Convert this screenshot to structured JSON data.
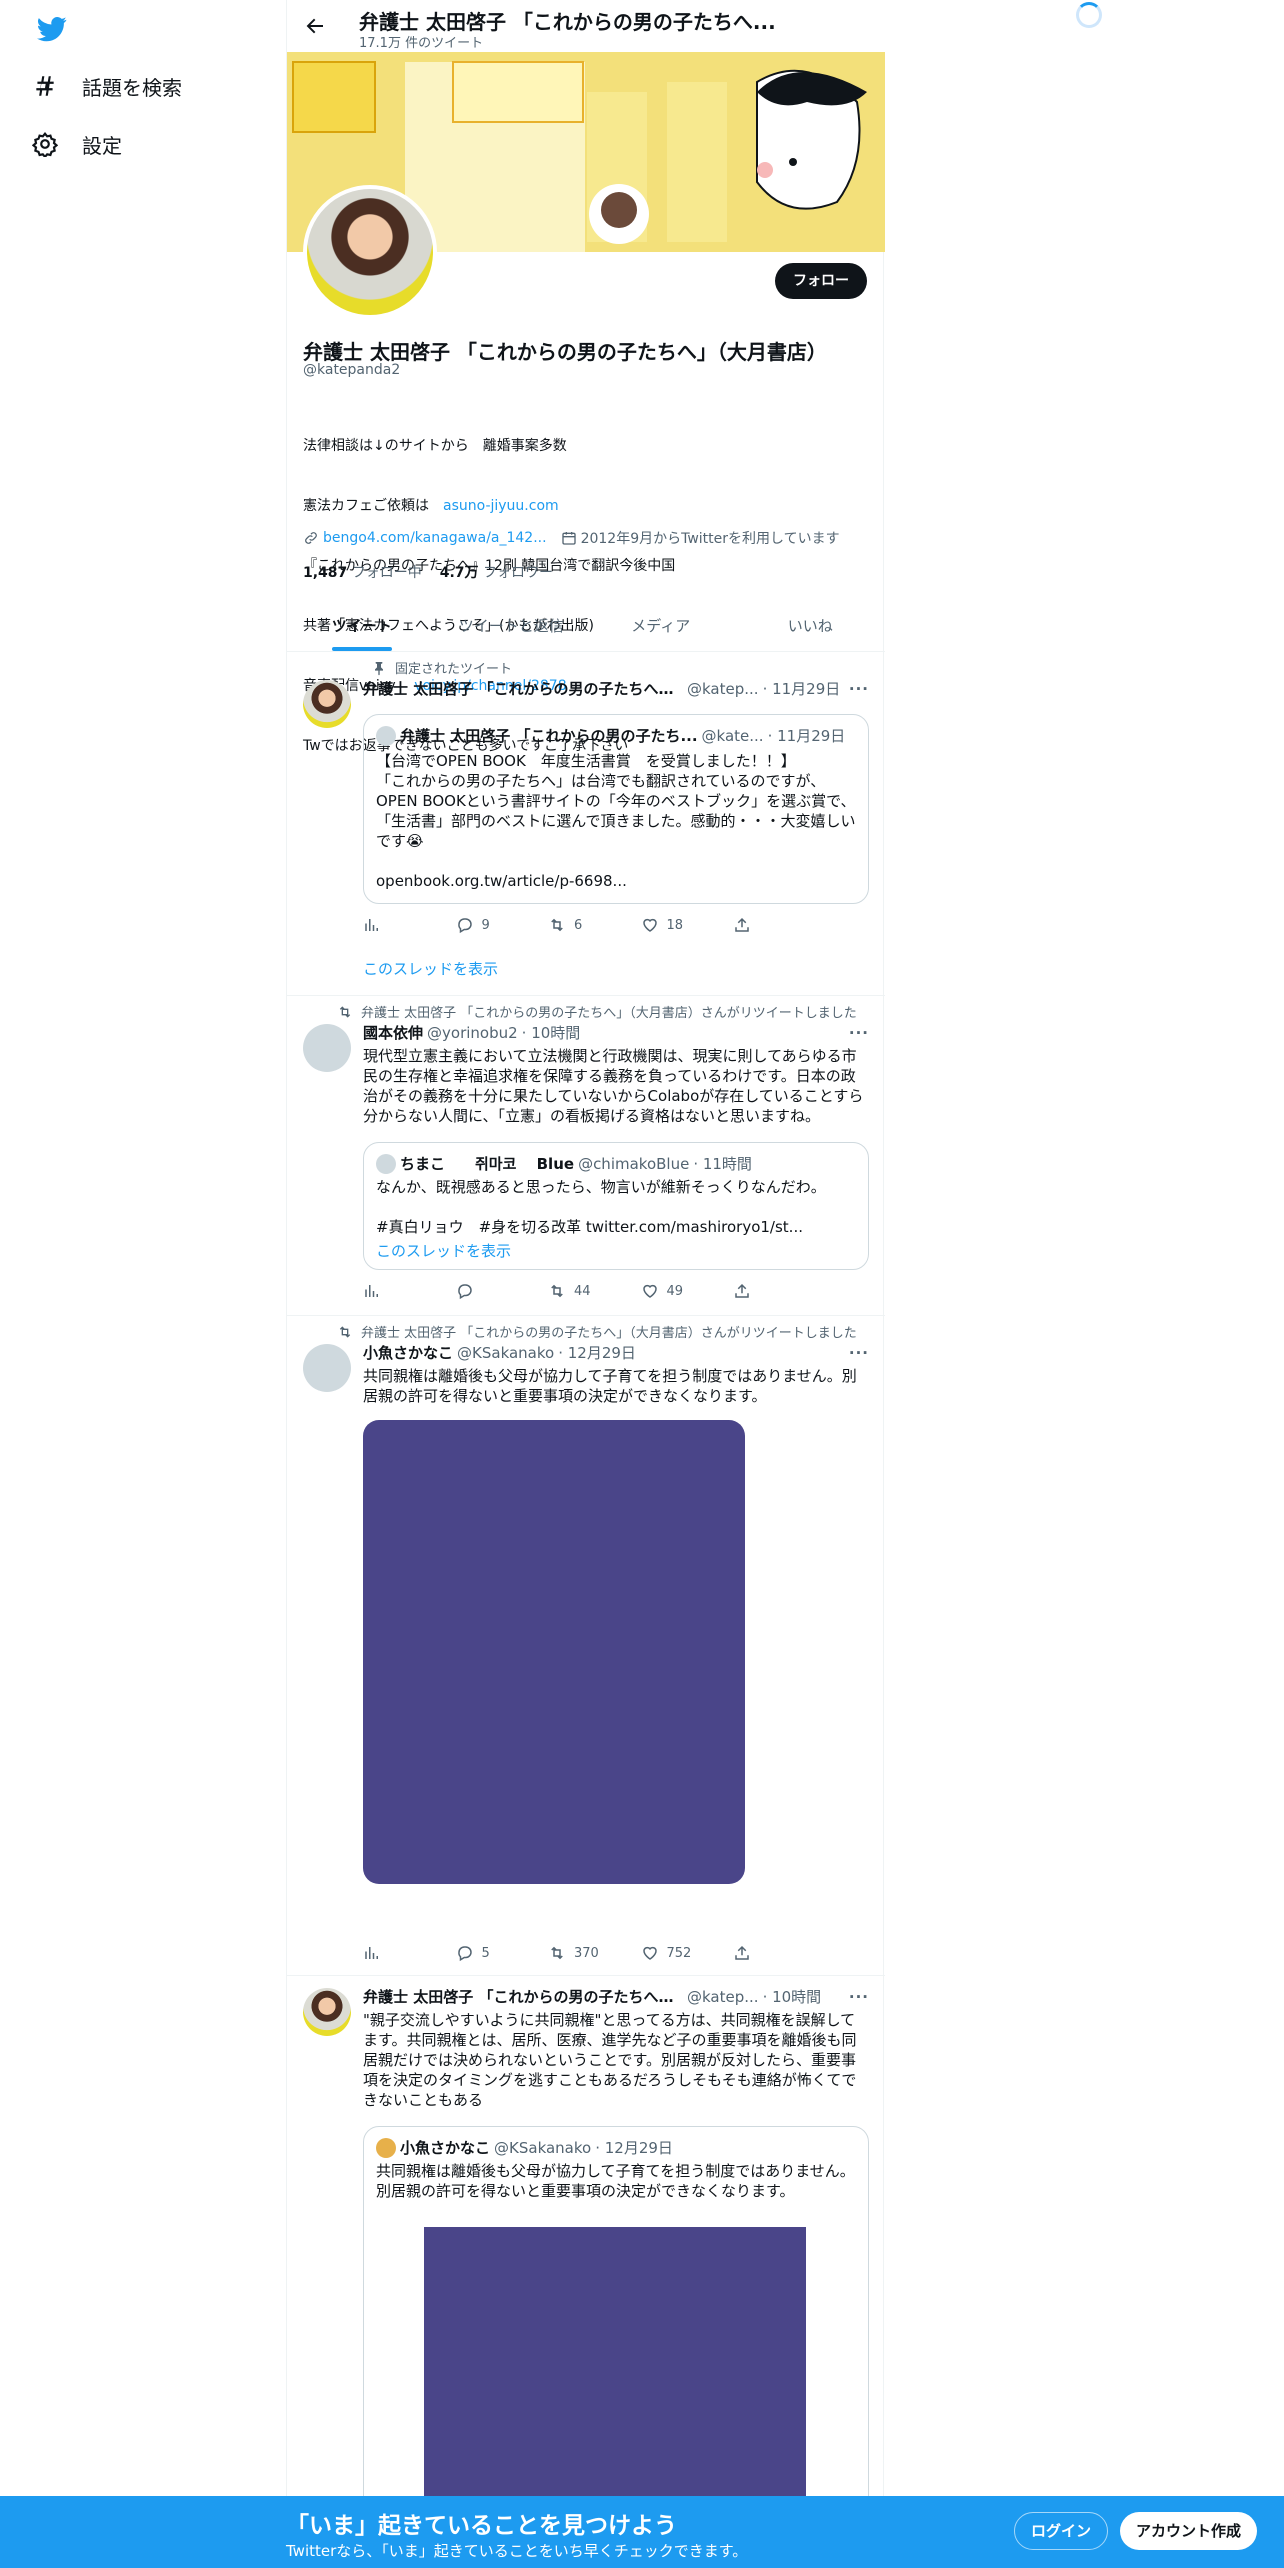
{
  "nav": {
    "explore_label": "話題を検索",
    "settings_label": "設定"
  },
  "header": {
    "title": "弁護士 太田啓子 「これからの男の子たちへ...",
    "subtitle": "17.1万 件のツイート"
  },
  "profile": {
    "follow_label": "フォロー",
    "name": "弁護士 太田啓子 「これからの男の子たちへ」（大月書店）",
    "handle": "@katepanda2",
    "bio_lines": [
      "法律相談は↓のサイトから　離婚事案多数",
      "憲法カフェご依頼は",
      "『これからの男の子たちへ』12刷 韓国台湾で翻訳今後中国",
      "共著「憲法カフェへようこそ」(かもがわ出版)",
      "音声配信voicy",
      "Twではお返事できないことも多いですご了承下さい"
    ],
    "bio_link1": "asuno-jiyuu.com",
    "bio_link2": "voicy.jp/channel/2878",
    "website": "bengo4.com/kanagawa/a_142...",
    "joined": "2012年9月からTwitterを利用しています",
    "following_count": "1,487",
    "following_label": "フォロー中",
    "followers_count": "4.7万",
    "followers_label": "フォロワー"
  },
  "tabs": [
    "ツイート",
    "ツイートと返信",
    "メディア",
    "いいね"
  ],
  "tweets": [
    {
      "context": "固定されたツイート",
      "name": "弁護士 太田啓子 「これからの男の子たちへ」...",
      "handle": "@katep...",
      "time": "· 11月29日",
      "quote": {
        "name": "弁護士 太田啓子 「これからの男の子たち...",
        "handle": "@kate...",
        "time": "· 11月29日",
        "text": "【台湾でOPEN BOOK　年度生活書賞　を受賞しました！！】\n「これからの男の子たちへ」は台湾でも翻訳されているのですが、OPEN BOOKという書評サイトの「今年のベストブック」を選ぶ賞で、「生活書」部門のベストに選んで頂きました。感動的・・・大変嬉しいです😭",
        "link": "openbook.org.tw/article/p-6698..."
      },
      "replies": "9",
      "retweets": "6",
      "likes": "18",
      "show_thread": "このスレッドを表示"
    },
    {
      "context": "弁護士 太田啓子 「これからの男の子たちへ」（大月書店）さんがリツイートしました",
      "name": "國本依伸",
      "handle": "@yorinobu2",
      "time": "· 10時間",
      "text": "現代型立憲主義において立法機関と行政機関は、現実に則してあらゆる市民の生存権と幸福追求権を保障する義務を負っているわけです。日本の政治がその義務を十分に果たしていないからColaboが存在していることすら分からない人間に、「立憲」の看板掲げる資格はないと思いますね。",
      "quote": {
        "name": "ちまこ　　쥐마코　 Blue",
        "handle": "@chimakoBlue",
        "time": "· 11時間",
        "text": "なんか、既視感あると思ったら、物言いが維新そっくりなんだわ。\n\n#真白リョウ　#身を切る改革 twitter.com/mashiroryo1/st...",
        "show_thread": "このスレッドを表示"
      },
      "replies": "",
      "retweets": "44",
      "likes": "49"
    },
    {
      "context": "弁護士 太田啓子 「これからの男の子たちへ」（大月書店）さんがリツイートしました",
      "name": "小魚さかなこ",
      "handle": "@KSakanako",
      "time": "· 12月29日",
      "text": "共同親権は離婚後も父母が協力して子育てを担う制度ではありません。別居親の許可を得ないと重要事項の決定ができなくなります。",
      "replies": "5",
      "retweets": "370",
      "likes": "752"
    },
    {
      "name": "弁護士 太田啓子 「これからの男の子たちへ」...",
      "handle": "@katep...",
      "time": "· 10時間",
      "text": "\"親子交流しやすいように共同親権\"と思ってる方は、共同親権を誤解してます。共同親権とは、居所、医療、進学先など子の重要事項を離婚後も同居親だけでは決められないということです。別居親が反対したら、重要事項を決定のタイミングを逃すこともあるだろうしそもそも連絡が怖くてできないこともある",
      "quote": {
        "name": "小魚さかなこ",
        "handle": "@KSakanako",
        "time": "· 12月29日",
        "text": "共同親権は離婚後も父母が協力して子育てを担う制度ではありません。別居親の許可を得ないと重要事項の決定ができなくなります。"
      }
    }
  ],
  "bottom_bar": {
    "title": "「いま」起きていることを見つけよう",
    "subtitle": "Twitterなら、「いま」起きていることをいち早くチェックできます。",
    "login_label": "ログイン",
    "signup_label": "アカウント作成"
  },
  "colors": {
    "accent": "#1d9bf0",
    "banner": "#f3e07a",
    "media": "#4a4589"
  }
}
